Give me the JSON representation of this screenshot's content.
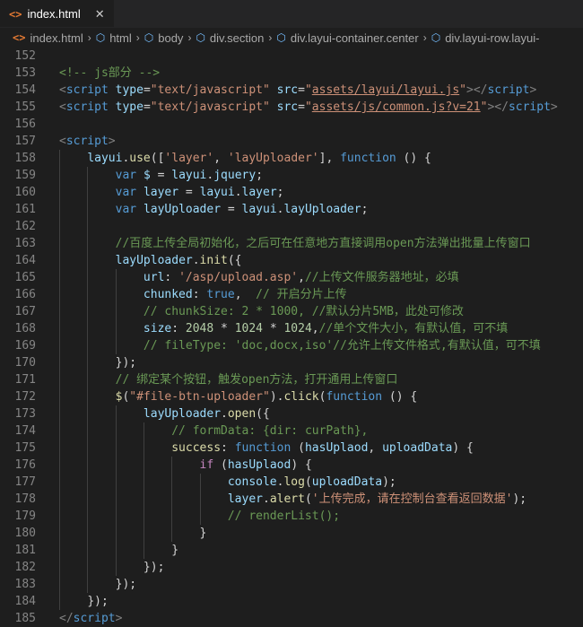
{
  "tab": {
    "label": "index.html",
    "icon": "html-file-icon",
    "close": "✕"
  },
  "breadcrumb": [
    {
      "label": "index.html",
      "icon": "html-file-icon"
    },
    {
      "label": "html",
      "icon": "element-icon"
    },
    {
      "label": "body",
      "icon": "element-icon"
    },
    {
      "label": "div.section",
      "icon": "element-icon"
    },
    {
      "label": "div.layui-container.center",
      "icon": "element-icon"
    },
    {
      "label": "div.layui-row.layui-",
      "icon": "element-icon"
    }
  ],
  "colors": {
    "background": "#1e1e1e",
    "keyword": "#569cd6",
    "control": "#c586c0",
    "string": "#ce9178",
    "function": "#dcdcaa",
    "variable": "#9cdcfe",
    "comment": "#6a9955",
    "line_number": "#858585"
  },
  "code": [
    {
      "n": "152",
      "indent": 0,
      "tokens": []
    },
    {
      "n": "153",
      "indent": 0,
      "tokens": [
        [
          "cm",
          "<!-- js部分 -->"
        ]
      ]
    },
    {
      "n": "154",
      "indent": 0,
      "tokens": [
        [
          "br",
          "<"
        ],
        [
          "tag",
          "script"
        ],
        [
          "pl",
          " "
        ],
        [
          "attr",
          "type"
        ],
        [
          "pl",
          "="
        ],
        [
          "str",
          "\"text/javascript\""
        ],
        [
          "pl",
          " "
        ],
        [
          "attr",
          "src"
        ],
        [
          "pl",
          "="
        ],
        [
          "str",
          "\""
        ],
        [
          "strl",
          "assets/layui/layui.js"
        ],
        [
          "str",
          "\""
        ],
        [
          "br",
          "></"
        ],
        [
          "tag",
          "script"
        ],
        [
          "br",
          ">"
        ]
      ]
    },
    {
      "n": "155",
      "indent": 0,
      "tokens": [
        [
          "br",
          "<"
        ],
        [
          "tag",
          "script"
        ],
        [
          "pl",
          " "
        ],
        [
          "attr",
          "type"
        ],
        [
          "pl",
          "="
        ],
        [
          "str",
          "\"text/javascript\""
        ],
        [
          "pl",
          " "
        ],
        [
          "attr",
          "src"
        ],
        [
          "pl",
          "="
        ],
        [
          "str",
          "\""
        ],
        [
          "strl",
          "assets/js/common.js?v=21"
        ],
        [
          "str",
          "\""
        ],
        [
          "br",
          "></"
        ],
        [
          "tag",
          "script"
        ],
        [
          "br",
          ">"
        ]
      ]
    },
    {
      "n": "156",
      "indent": 0,
      "tokens": []
    },
    {
      "n": "157",
      "indent": 0,
      "tokens": [
        [
          "br",
          "<"
        ],
        [
          "tag",
          "script"
        ],
        [
          "br",
          ">"
        ]
      ]
    },
    {
      "n": "158",
      "indent": 1,
      "tokens": [
        [
          "var",
          "layui"
        ],
        [
          "pl",
          "."
        ],
        [
          "fn",
          "use"
        ],
        [
          "pl",
          "(["
        ],
        [
          "str",
          "'layer'"
        ],
        [
          "pl",
          ", "
        ],
        [
          "str",
          "'layUploader'"
        ],
        [
          "pl",
          "], "
        ],
        [
          "kw",
          "function"
        ],
        [
          "pl",
          " () {"
        ]
      ]
    },
    {
      "n": "159",
      "indent": 2,
      "tokens": [
        [
          "kw",
          "var"
        ],
        [
          "pl",
          " "
        ],
        [
          "var",
          "$"
        ],
        [
          "pl",
          " = "
        ],
        [
          "var",
          "layui"
        ],
        [
          "pl",
          "."
        ],
        [
          "var",
          "jquery"
        ],
        [
          "pl",
          ";"
        ]
      ]
    },
    {
      "n": "160",
      "indent": 2,
      "tokens": [
        [
          "kw",
          "var"
        ],
        [
          "pl",
          " "
        ],
        [
          "var",
          "layer"
        ],
        [
          "pl",
          " = "
        ],
        [
          "var",
          "layui"
        ],
        [
          "pl",
          "."
        ],
        [
          "var",
          "layer"
        ],
        [
          "pl",
          ";"
        ]
      ]
    },
    {
      "n": "161",
      "indent": 2,
      "tokens": [
        [
          "kw",
          "var"
        ],
        [
          "pl",
          " "
        ],
        [
          "var",
          "layUploader"
        ],
        [
          "pl",
          " = "
        ],
        [
          "var",
          "layui"
        ],
        [
          "pl",
          "."
        ],
        [
          "var",
          "layUploader"
        ],
        [
          "pl",
          ";"
        ]
      ]
    },
    {
      "n": "162",
      "indent": 2,
      "tokens": []
    },
    {
      "n": "163",
      "indent": 2,
      "tokens": [
        [
          "cm",
          "//百度上传全局初始化，之后可在任意地方直接调用open方法弹出批量上传窗口"
        ]
      ]
    },
    {
      "n": "164",
      "indent": 2,
      "tokens": [
        [
          "var",
          "layUploader"
        ],
        [
          "pl",
          "."
        ],
        [
          "fn",
          "init"
        ],
        [
          "pl",
          "({"
        ]
      ]
    },
    {
      "n": "165",
      "indent": 3,
      "tokens": [
        [
          "var",
          "url"
        ],
        [
          "pl",
          ": "
        ],
        [
          "str",
          "'/asp/upload.asp'"
        ],
        [
          "pl",
          ","
        ],
        [
          "cm",
          "//上传文件服务器地址，必填"
        ]
      ]
    },
    {
      "n": "166",
      "indent": 3,
      "tokens": [
        [
          "var",
          "chunked"
        ],
        [
          "pl",
          ": "
        ],
        [
          "kw",
          "true"
        ],
        [
          "pl",
          ",  "
        ],
        [
          "cm",
          "// 开启分片上传"
        ]
      ]
    },
    {
      "n": "167",
      "indent": 3,
      "tokens": [
        [
          "cm",
          "// chunkSize: 2 * 1000, //默认分片5MB，此处可修改"
        ]
      ]
    },
    {
      "n": "168",
      "indent": 3,
      "tokens": [
        [
          "var",
          "size"
        ],
        [
          "pl",
          ": "
        ],
        [
          "num",
          "2048"
        ],
        [
          "pl",
          " * "
        ],
        [
          "num",
          "1024"
        ],
        [
          "pl",
          " * "
        ],
        [
          "num",
          "1024"
        ],
        [
          "pl",
          ","
        ],
        [
          "cm",
          "//单个文件大小，有默认值，可不填"
        ]
      ]
    },
    {
      "n": "169",
      "indent": 3,
      "tokens": [
        [
          "cm",
          "// fileType: 'doc,docx,iso'//允许上传文件格式,有默认值，可不填"
        ]
      ]
    },
    {
      "n": "170",
      "indent": 2,
      "tokens": [
        [
          "pl",
          "});"
        ]
      ]
    },
    {
      "n": "171",
      "indent": 2,
      "tokens": [
        [
          "cm",
          "// 绑定某个按钮，触发open方法，打开通用上传窗口"
        ]
      ]
    },
    {
      "n": "172",
      "indent": 2,
      "tokens": [
        [
          "fn",
          "$"
        ],
        [
          "pl",
          "("
        ],
        [
          "str",
          "\"#file-btn-uploader\""
        ],
        [
          "pl",
          ")."
        ],
        [
          "fn",
          "click"
        ],
        [
          "pl",
          "("
        ],
        [
          "kw",
          "function"
        ],
        [
          "pl",
          " () {"
        ]
      ]
    },
    {
      "n": "173",
      "indent": 3,
      "tokens": [
        [
          "var",
          "layUploader"
        ],
        [
          "pl",
          "."
        ],
        [
          "fn",
          "open"
        ],
        [
          "pl",
          "({"
        ]
      ]
    },
    {
      "n": "174",
      "indent": 4,
      "tokens": [
        [
          "cm",
          "// formData: {dir: curPath},"
        ]
      ]
    },
    {
      "n": "175",
      "indent": 4,
      "tokens": [
        [
          "fn",
          "success"
        ],
        [
          "pl",
          ": "
        ],
        [
          "kw",
          "function"
        ],
        [
          "pl",
          " ("
        ],
        [
          "var",
          "hasUplaod"
        ],
        [
          "pl",
          ", "
        ],
        [
          "var",
          "uploadData"
        ],
        [
          "pl",
          ") {"
        ]
      ]
    },
    {
      "n": "176",
      "indent": 5,
      "tokens": [
        [
          "ctl",
          "if"
        ],
        [
          "pl",
          " ("
        ],
        [
          "var",
          "hasUplaod"
        ],
        [
          "pl",
          ") {"
        ]
      ]
    },
    {
      "n": "177",
      "indent": 6,
      "tokens": [
        [
          "var",
          "console"
        ],
        [
          "pl",
          "."
        ],
        [
          "fn",
          "log"
        ],
        [
          "pl",
          "("
        ],
        [
          "var",
          "uploadData"
        ],
        [
          "pl",
          ");"
        ]
      ]
    },
    {
      "n": "178",
      "indent": 6,
      "tokens": [
        [
          "var",
          "layer"
        ],
        [
          "pl",
          "."
        ],
        [
          "fn",
          "alert"
        ],
        [
          "pl",
          "("
        ],
        [
          "str",
          "'上传完成，请在控制台查看返回数据'"
        ],
        [
          "pl",
          ");"
        ]
      ]
    },
    {
      "n": "179",
      "indent": 6,
      "tokens": [
        [
          "cm",
          "// renderList();"
        ]
      ]
    },
    {
      "n": "180",
      "indent": 5,
      "tokens": [
        [
          "pl",
          "}"
        ]
      ]
    },
    {
      "n": "181",
      "indent": 4,
      "tokens": [
        [
          "pl",
          "}"
        ]
      ]
    },
    {
      "n": "182",
      "indent": 3,
      "tokens": [
        [
          "pl",
          "});"
        ]
      ]
    },
    {
      "n": "183",
      "indent": 2,
      "tokens": [
        [
          "pl",
          "});"
        ]
      ]
    },
    {
      "n": "184",
      "indent": 1,
      "tokens": [
        [
          "pl",
          "});"
        ]
      ]
    },
    {
      "n": "185",
      "indent": 0,
      "tokens": [
        [
          "br",
          "</"
        ],
        [
          "tag",
          "script"
        ],
        [
          "br",
          ">"
        ]
      ]
    }
  ]
}
